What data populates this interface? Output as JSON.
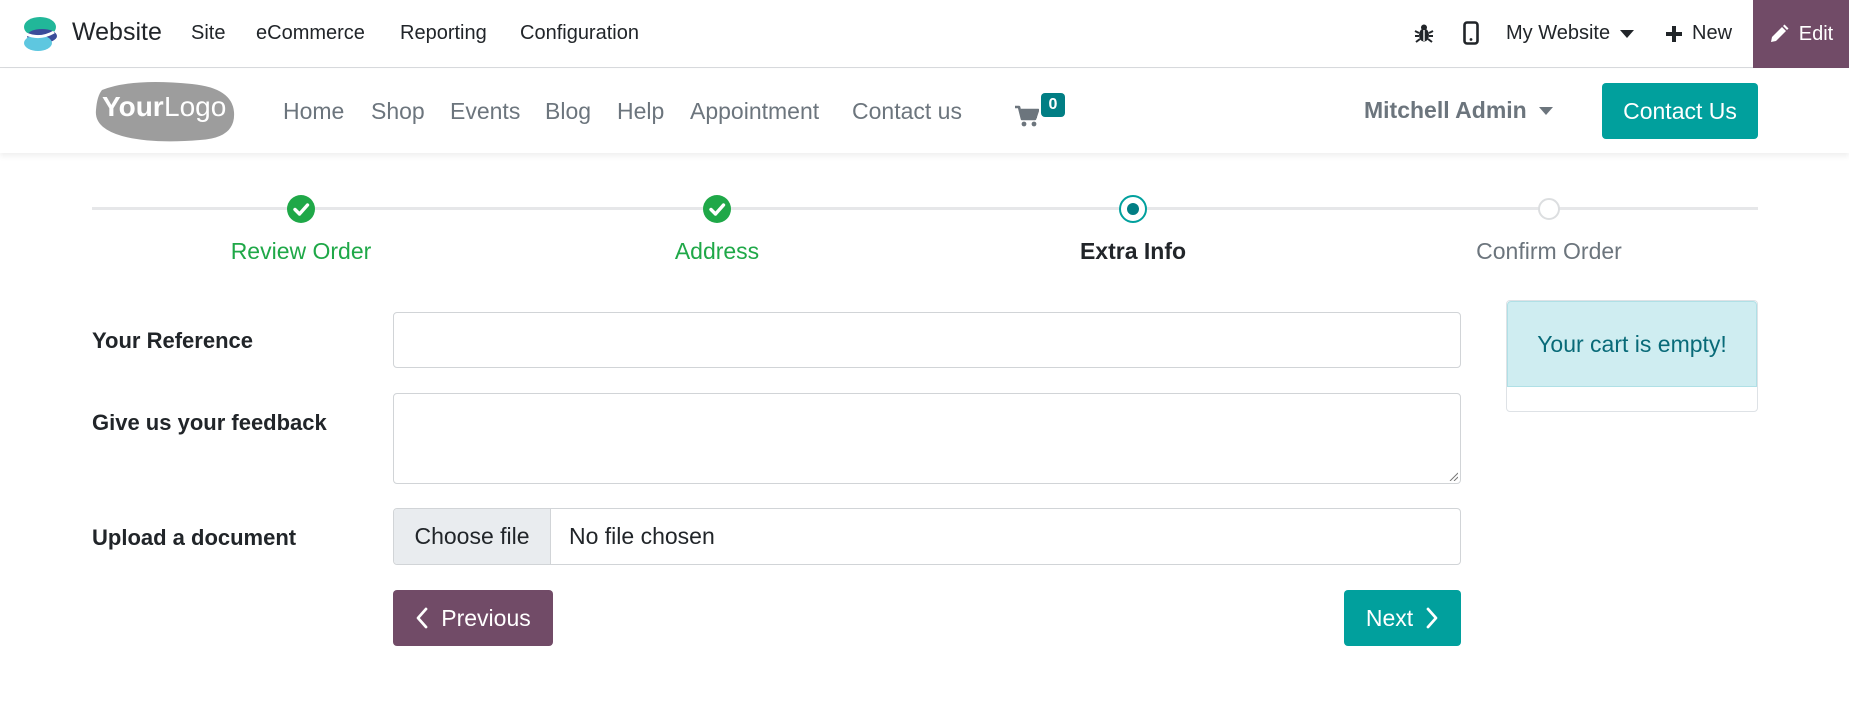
{
  "topbar": {
    "app_name": "Website",
    "menus": [
      "Site",
      "eCommerce",
      "Reporting",
      "Configuration"
    ],
    "website_switcher": "My Website",
    "new_label": "New",
    "edit_label": "Edit"
  },
  "header": {
    "logo_text": "YourLogo",
    "nav": [
      "Home",
      "Shop",
      "Events",
      "Blog",
      "Help",
      "Appointment",
      "Contact us"
    ],
    "cart_count": "0",
    "user_name": "Mitchell Admin",
    "contact_button": "Contact Us"
  },
  "wizard": {
    "steps": [
      {
        "label": "Review Order",
        "state": "done"
      },
      {
        "label": "Address",
        "state": "done"
      },
      {
        "label": "Extra Info",
        "state": "current"
      },
      {
        "label": "Confirm Order",
        "state": "todo"
      }
    ]
  },
  "form": {
    "reference_label": "Your Reference",
    "reference_value": "",
    "feedback_label": "Give us your feedback",
    "feedback_value": "",
    "upload_label": "Upload a document",
    "choose_file": "Choose file",
    "no_file": "No file chosen",
    "previous": "Previous",
    "next": "Next"
  },
  "cart_summary": {
    "message": "Your cart is empty!"
  },
  "colors": {
    "brand": "#714b67",
    "primary": "#01a09d",
    "success": "#1fa848",
    "info_bg": "#cfedf1",
    "info_text": "#086a78"
  }
}
